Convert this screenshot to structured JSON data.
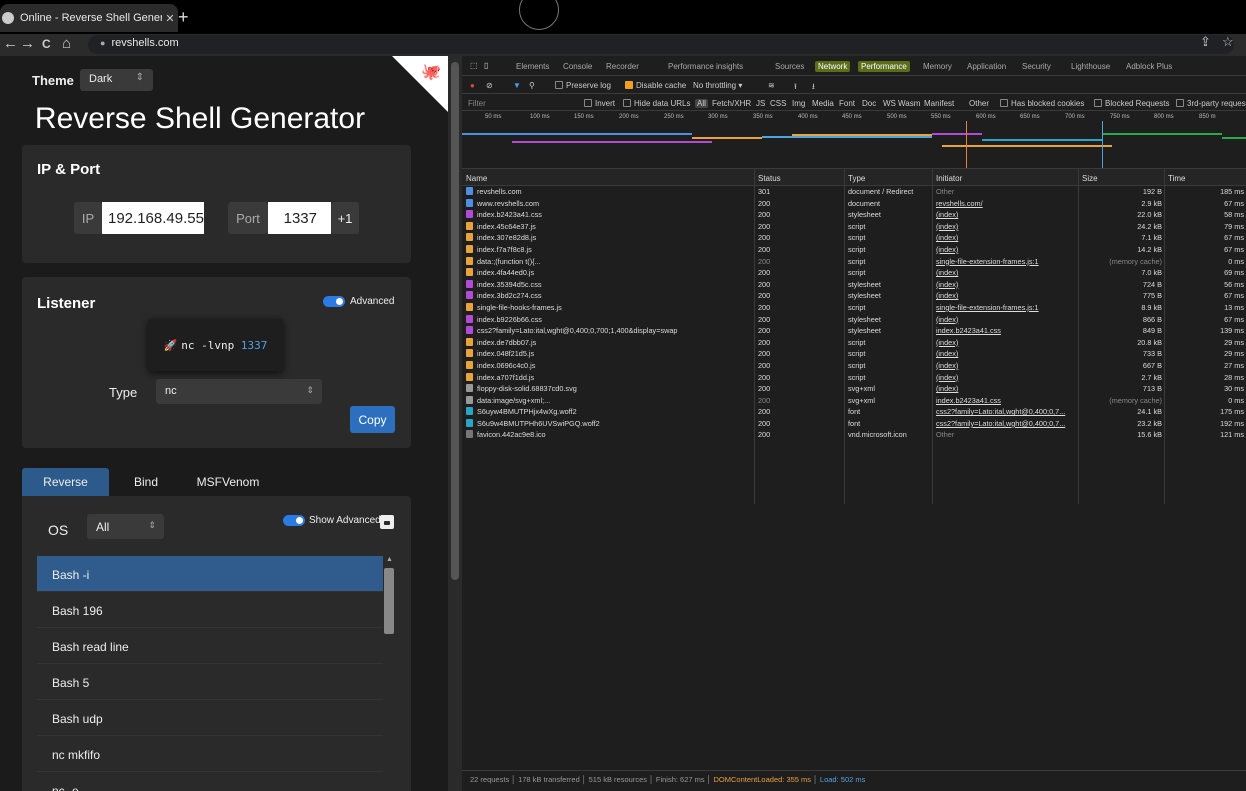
{
  "browser": {
    "tab_title": "Online - Reverse Shell Generator",
    "new_tab": "+",
    "url": "revshells.com",
    "nav": {
      "back": "←",
      "forward": "→",
      "reload": "C",
      "home": "⌂"
    }
  },
  "revshell": {
    "theme_label": "Theme",
    "theme_value": "Dark",
    "title": "Reverse Shell Generator",
    "ip_port": {
      "heading": "IP & Port",
      "ip_label": "IP",
      "ip_value": "192.168.49.55",
      "port_label": "Port",
      "port_value": "1337",
      "plus_label": "+1"
    },
    "listener": {
      "heading": "Listener",
      "advanced_label": "Advanced",
      "command_prefix": "nc -lvnp ",
      "command_port": "1337",
      "type_label": "Type",
      "type_value": "nc",
      "copy_label": "Copy"
    },
    "shell_tabs": [
      "Reverse",
      "Bind",
      "MSFVenom"
    ],
    "os_label": "OS",
    "os_value": "All",
    "show_advanced_label": "Show Advanced",
    "shells": [
      "Bash -i",
      "Bash 196",
      "Bash read line",
      "Bash 5",
      "Bash udp",
      "nc mkfifo",
      "nc -e"
    ]
  },
  "devtools": {
    "tabs": [
      "Elements",
      "Console",
      "Recorder",
      "Performance insights",
      "Sources",
      "Network",
      "Performance",
      "Memory",
      "Application",
      "Security",
      "Lighthouse",
      "Adblock Plus"
    ],
    "active_tab": "Network",
    "toolbar": {
      "preserve_log": "Preserve log",
      "disable_cache": "Disable cache",
      "throttling": "No throttling"
    },
    "filter": {
      "placeholder": "Filter",
      "invert": "Invert",
      "hide_data_urls": "Hide data URLs",
      "types": [
        "All",
        "Fetch/XHR",
        "JS",
        "CSS",
        "Img",
        "Media",
        "Font",
        "Doc",
        "WS",
        "Wasm",
        "Manifest",
        "Other"
      ],
      "has_blocked_cookies": "Has blocked cookies",
      "blocked_requests": "Blocked Requests",
      "third_party": "3rd-party reques"
    },
    "timeline_ticks": [
      "50 ms",
      "100 ms",
      "150 ms",
      "200 ms",
      "250 ms",
      "300 ms",
      "350 ms",
      "400 ms",
      "450 ms",
      "500 ms",
      "550 ms",
      "600 ms",
      "650 ms",
      "700 ms",
      "750 ms",
      "800 ms",
      "850 m"
    ],
    "columns": [
      "Name",
      "Status",
      "Type",
      "Initiator",
      "Size",
      "Time"
    ],
    "requests": [
      {
        "name": "revshells.com",
        "status": "301",
        "type": "document / Redirect",
        "initiator": "Other",
        "size": "192 B",
        "time": "185 ms",
        "icon": "doc"
      },
      {
        "name": "www.revshells.com",
        "status": "200",
        "type": "document",
        "initiator": "revshells.com/",
        "size": "2.9 kB",
        "time": "67 ms",
        "icon": "doc"
      },
      {
        "name": "index.b2423a41.css",
        "status": "200",
        "type": "stylesheet",
        "initiator": "(index)",
        "size": "22.0 kB",
        "time": "58 ms",
        "icon": "css"
      },
      {
        "name": "index.45c64e37.js",
        "status": "200",
        "type": "script",
        "initiator": "(index)",
        "size": "24.2 kB",
        "time": "79 ms",
        "icon": "js"
      },
      {
        "name": "index.307e82d8.js",
        "status": "200",
        "type": "script",
        "initiator": "(index)",
        "size": "7.1 kB",
        "time": "67 ms",
        "icon": "js"
      },
      {
        "name": "index.f7a7f8c8.js",
        "status": "200",
        "type": "script",
        "initiator": "(index)",
        "size": "14.2 kB",
        "time": "67 ms",
        "icon": "js"
      },
      {
        "name": "data:;(function t(){...",
        "status": "200",
        "type": "script",
        "initiator": "single-file-extension-frames.js:1",
        "size": "(memory cache)",
        "time": "0 ms",
        "icon": "js"
      },
      {
        "name": "index.4fa44ed0.js",
        "status": "200",
        "type": "script",
        "initiator": "(index)",
        "size": "7.0 kB",
        "time": "69 ms",
        "icon": "js"
      },
      {
        "name": "index.35394d5c.css",
        "status": "200",
        "type": "stylesheet",
        "initiator": "(index)",
        "size": "724 B",
        "time": "56 ms",
        "icon": "css"
      },
      {
        "name": "index.3bd2c274.css",
        "status": "200",
        "type": "stylesheet",
        "initiator": "(index)",
        "size": "775 B",
        "time": "67 ms",
        "icon": "css"
      },
      {
        "name": "single-file-hooks-frames.js",
        "status": "200",
        "type": "script",
        "initiator": "single-file-extension-frames.js:1",
        "size": "8.9 kB",
        "time": "13 ms",
        "icon": "js"
      },
      {
        "name": "index.b9226b66.css",
        "status": "200",
        "type": "stylesheet",
        "initiator": "(index)",
        "size": "866 B",
        "time": "67 ms",
        "icon": "css"
      },
      {
        "name": "css2?family=Lato:ital,wght@0,400;0,700;1,400&display=swap",
        "status": "200",
        "type": "stylesheet",
        "initiator": "index.b2423a41.css",
        "size": "849 B",
        "time": "139 ms",
        "icon": "css"
      },
      {
        "name": "index.de7dbb07.js",
        "status": "200",
        "type": "script",
        "initiator": "(index)",
        "size": "20.8 kB",
        "time": "29 ms",
        "icon": "js"
      },
      {
        "name": "index.048f21d5.js",
        "status": "200",
        "type": "script",
        "initiator": "(index)",
        "size": "733 B",
        "time": "29 ms",
        "icon": "js"
      },
      {
        "name": "index.0696c4c0.js",
        "status": "200",
        "type": "script",
        "initiator": "(index)",
        "size": "667 B",
        "time": "27 ms",
        "icon": "js"
      },
      {
        "name": "index.a707f1dd.js",
        "status": "200",
        "type": "script",
        "initiator": "(index)",
        "size": "2.7 kB",
        "time": "28 ms",
        "icon": "js"
      },
      {
        "name": "floppy-disk-solid.68837cd0.svg",
        "status": "200",
        "type": "svg+xml",
        "initiator": "(index)",
        "size": "713 B",
        "time": "30 ms",
        "icon": "img"
      },
      {
        "name": "data:image/svg+xml;...",
        "status": "200",
        "type": "svg+xml",
        "initiator": "index.b2423a41.css",
        "size": "(memory cache)",
        "time": "0 ms",
        "icon": "img"
      },
      {
        "name": "S6uyw4BMUTPHjx4wXg.woff2",
        "status": "200",
        "type": "font",
        "initiator": "css2?family=Lato:ital,wght@0,400;0,7...",
        "size": "24.1 kB",
        "time": "175 ms",
        "icon": "font"
      },
      {
        "name": "S6u9w4BMUTPHh6UVSwiPGQ.woff2",
        "status": "200",
        "type": "font",
        "initiator": "css2?family=Lato:ital,wght@0,400;0,7...",
        "size": "23.2 kB",
        "time": "192 ms",
        "icon": "font"
      },
      {
        "name": "favicon.442ac9e8.ico",
        "status": "200",
        "type": "vnd.microsoft.icon",
        "initiator": "Other",
        "size": "15.6 kB",
        "time": "121 ms",
        "icon": "other"
      }
    ],
    "footer": {
      "requests": "22 requests",
      "transferred": "178 kB transferred",
      "resources": "515 kB resources",
      "finish": "Finish: 627 ms",
      "dcl": "DOMContentLoaded: 355 ms",
      "load": "Load: 502 ms"
    }
  },
  "colors": {
    "accent": "#2c7be5",
    "active_item": "#2f5c8c",
    "network_tab_highlight": "#5a6e1a",
    "css_icon": "#b24bd8",
    "js_icon": "#e8a33d",
    "doc_icon": "#4f8fe0",
    "font_icon": "#29a5c6"
  }
}
